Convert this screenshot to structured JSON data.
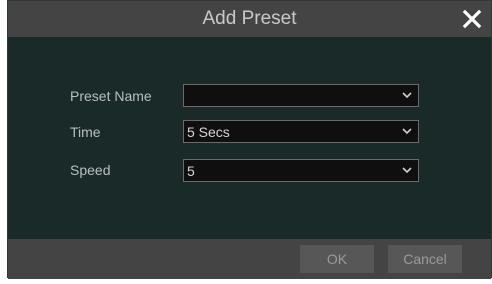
{
  "dialog": {
    "title": "Add Preset",
    "close_icon": "close-icon"
  },
  "form": {
    "preset_name": {
      "label": "Preset Name",
      "value": ""
    },
    "time": {
      "label": "Time",
      "value": "5 Secs"
    },
    "speed": {
      "label": "Speed",
      "value": "5"
    }
  },
  "footer": {
    "ok_label": "OK",
    "cancel_label": "Cancel"
  },
  "colors": {
    "panel_background": "#1a2a28",
    "bar_background": "#444444",
    "input_background": "#0f0f0f"
  }
}
